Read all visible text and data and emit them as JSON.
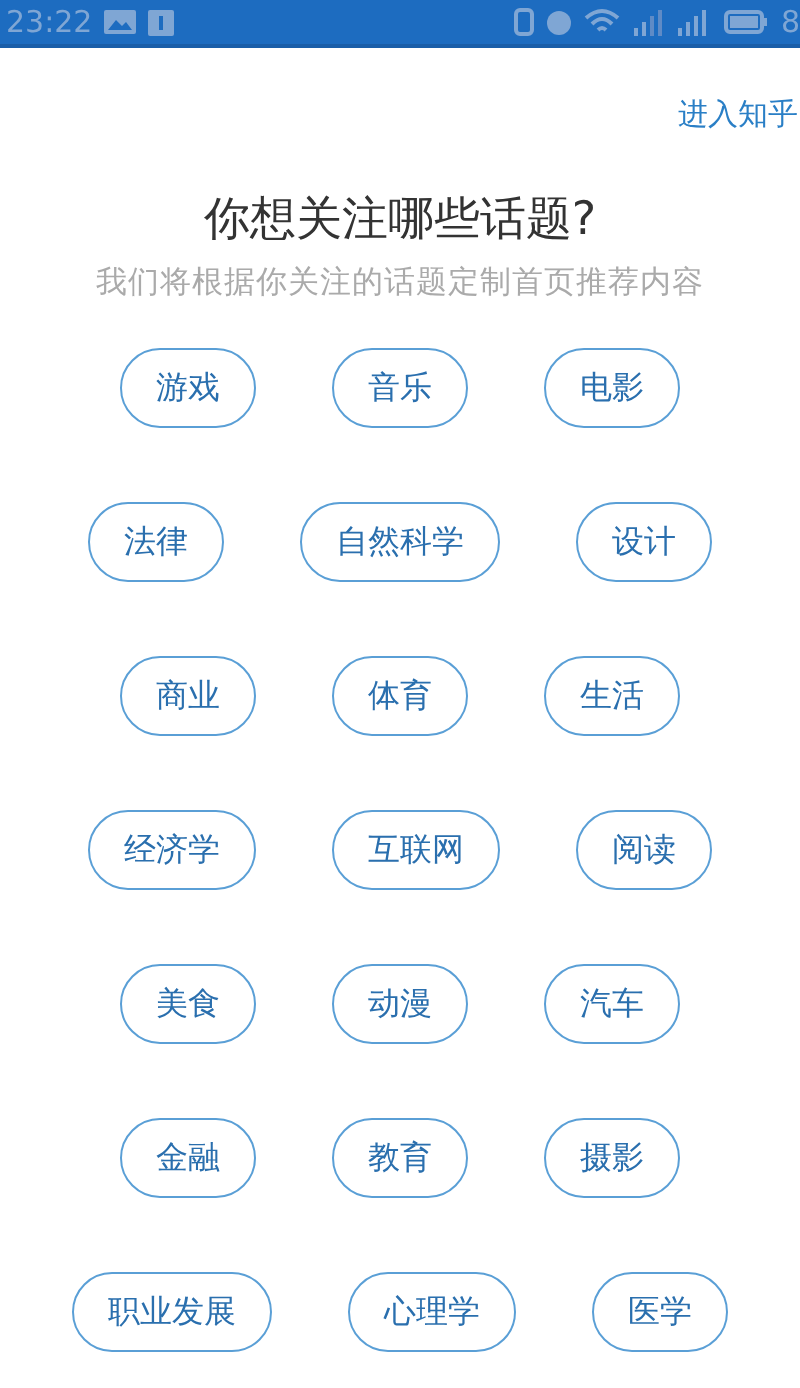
{
  "status_bar": {
    "time": "23:22",
    "battery": "8"
  },
  "skip_link": "进入知乎",
  "title": "你想关注哪些话题?",
  "subtitle": "我们将根据你关注的话题定制首页推荐内容",
  "topic_rows": [
    [
      {
        "label": "游戏",
        "selected": false
      },
      {
        "label": "音乐",
        "selected": false
      },
      {
        "label": "电影",
        "selected": false
      }
    ],
    [
      {
        "label": "法律",
        "selected": false
      },
      {
        "label": "自然科学",
        "selected": false
      },
      {
        "label": "设计",
        "selected": false
      }
    ],
    [
      {
        "label": "商业",
        "selected": false
      },
      {
        "label": "体育",
        "selected": false
      },
      {
        "label": "生活",
        "selected": false
      }
    ],
    [
      {
        "label": "经济学",
        "selected": false
      },
      {
        "label": "互联网",
        "selected": false
      },
      {
        "label": "阅读",
        "selected": false
      }
    ],
    [
      {
        "label": "美食",
        "selected": false
      },
      {
        "label": "动漫",
        "selected": false
      },
      {
        "label": "汽车",
        "selected": false
      }
    ],
    [
      {
        "label": "金融",
        "selected": false
      },
      {
        "label": "教育",
        "selected": false
      },
      {
        "label": "摄影",
        "selected": false
      }
    ],
    [
      {
        "label": "职业发展",
        "selected": false
      },
      {
        "label": "心理学",
        "selected": false
      },
      {
        "label": "医学",
        "selected": false
      }
    ]
  ]
}
